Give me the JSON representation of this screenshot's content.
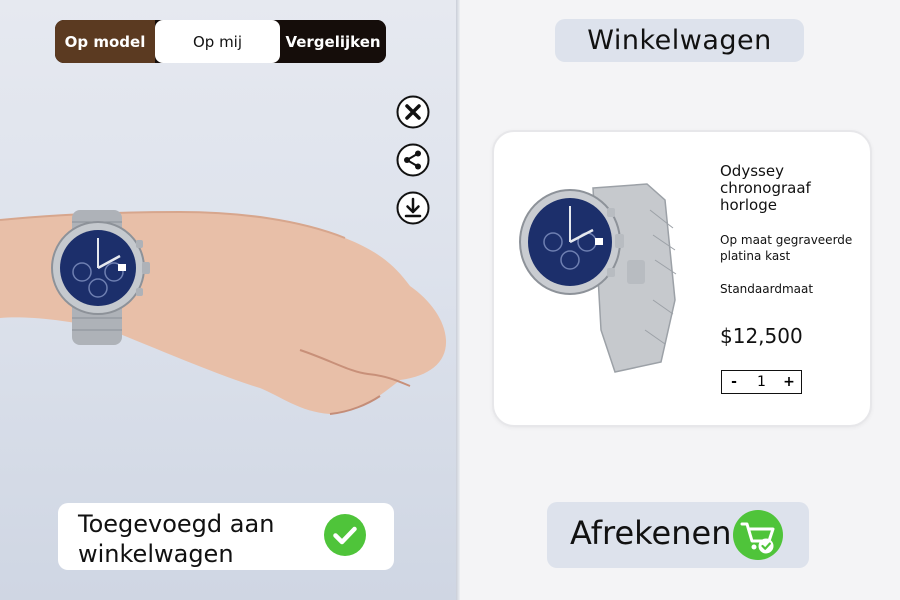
{
  "view_modes": {
    "on_model": "Op model",
    "on_me": "Op mij",
    "compare": "Vergelijken",
    "selected": "Op mij"
  },
  "tools": {
    "close_icon": "close-icon",
    "share_icon": "share-icon",
    "download_icon": "download-icon"
  },
  "toast": {
    "message": "Toegevoegd aan winkelwagen",
    "icon": "check-icon",
    "color": "#4fc43a"
  },
  "cart": {
    "title": "Winkelwagen",
    "item": {
      "name": "Odyssey chronograaf horloge",
      "description": "Op maat gegraveerde platina kast",
      "size": "Standaardmaat",
      "price": "$12,500",
      "quantity": "1",
      "minus": "-",
      "plus": "+"
    }
  },
  "checkout": {
    "label": "Afrekenen",
    "icon": "cart-check-icon",
    "color": "#4fc43a"
  },
  "colors": {
    "accent_brown": "#5b3a21",
    "dial_blue": "#1c2f6b",
    "success_green": "#4fc43a"
  }
}
